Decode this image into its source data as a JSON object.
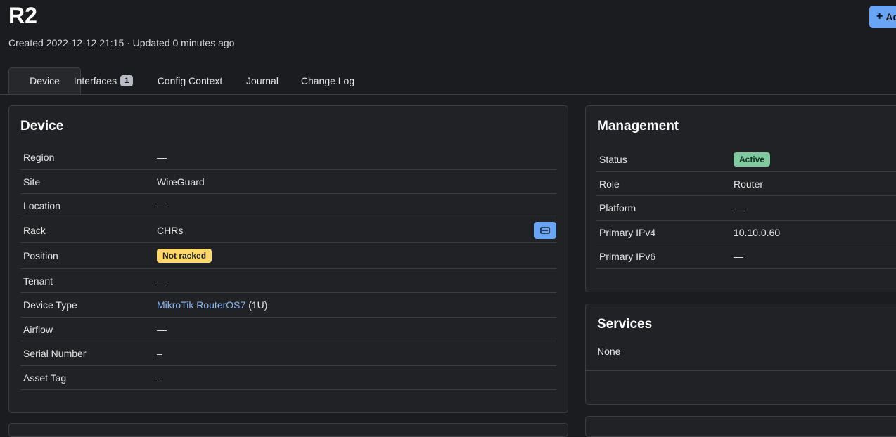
{
  "header": {
    "title": "R2",
    "subtitle": "Created 2022-12-12 21:15 · Updated 0 minutes ago",
    "add_button_label": "Ad"
  },
  "tabs": [
    {
      "label": "Device",
      "active": true
    },
    {
      "label": "Interfaces",
      "count": "1"
    },
    {
      "label": "Config Context"
    },
    {
      "label": "Journal"
    },
    {
      "label": "Change Log"
    }
  ],
  "device_card": {
    "title": "Device",
    "rows": [
      {
        "label": "Region",
        "value": "—"
      },
      {
        "label": "Site",
        "value": "WireGuard"
      },
      {
        "label": "Location",
        "value": "—"
      },
      {
        "label": "Rack",
        "value": "CHRs"
      },
      {
        "label": "Position",
        "value": "Not racked"
      },
      {
        "label": "Tenant",
        "value": "—"
      },
      {
        "label": "Device Type",
        "value": "MikroTik RouterOS7",
        "suffix": "(1U)"
      },
      {
        "label": "Airflow",
        "value": "—"
      },
      {
        "label": "Serial Number",
        "value": "–"
      },
      {
        "label": "Asset Tag",
        "value": "–"
      }
    ]
  },
  "management_card": {
    "title": "Management",
    "rows": [
      {
        "label": "Status",
        "value": "Active"
      },
      {
        "label": "Role",
        "value": "Router"
      },
      {
        "label": "Platform",
        "value": "—"
      },
      {
        "label": "Primary IPv4",
        "value": "10.10.0.60"
      },
      {
        "label": "Primary IPv6",
        "value": "—"
      }
    ]
  },
  "services_card": {
    "title": "Services",
    "empty_text": "None"
  },
  "colors": {
    "accent": "#6aa5f5",
    "link": "#8ab8f5",
    "warning_badge": "#ffd76b",
    "success_badge": "#7fc8a0"
  }
}
